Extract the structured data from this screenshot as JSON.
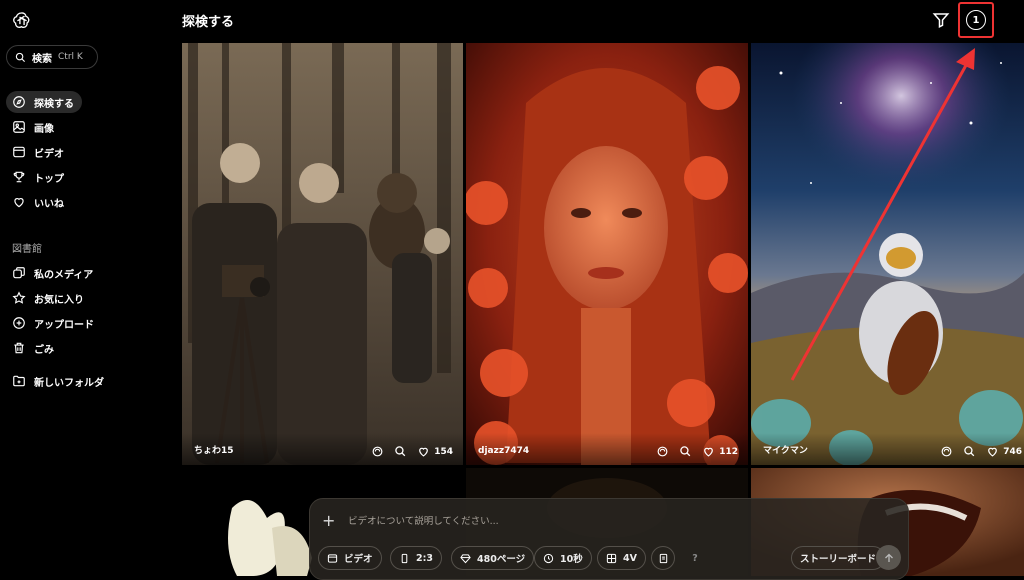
{
  "sidebar": {
    "search_label": "検索",
    "search_shortcut": "Ctrl K",
    "nav": [
      {
        "label": "探検する",
        "icon": "compass-icon"
      },
      {
        "label": "画像",
        "icon": "image-icon"
      },
      {
        "label": "ビデオ",
        "icon": "video-icon"
      },
      {
        "label": "トップ",
        "icon": "trophy-icon"
      },
      {
        "label": "いいね",
        "icon": "heart-icon"
      }
    ],
    "library_label": "図書館",
    "library": [
      {
        "label": "私のメディア",
        "icon": "media-icon"
      },
      {
        "label": "お気に入り",
        "icon": "star-icon"
      },
      {
        "label": "アップロード",
        "icon": "upload-icon"
      },
      {
        "label": "ごみ",
        "icon": "trash-icon"
      },
      {
        "label": "新しいフォルダ",
        "icon": "new-folder-icon"
      }
    ]
  },
  "header": {
    "title": "探検する",
    "count": "1"
  },
  "cards": [
    {
      "author": "ちょわ15",
      "likes": "154"
    },
    {
      "author": "djazz7474",
      "likes": "112"
    },
    {
      "author": "マイクマン",
      "likes": "746"
    }
  ],
  "composer": {
    "placeholder": "ビデオについて説明してください...",
    "chips": {
      "mode": "ビデオ",
      "ratio": "2:3",
      "quality": "480ページ",
      "duration": "10秒",
      "variations": "4V",
      "help": "?",
      "storyboard": "ストーリーボード"
    }
  },
  "colors": {
    "annotation": "#ee3333"
  }
}
